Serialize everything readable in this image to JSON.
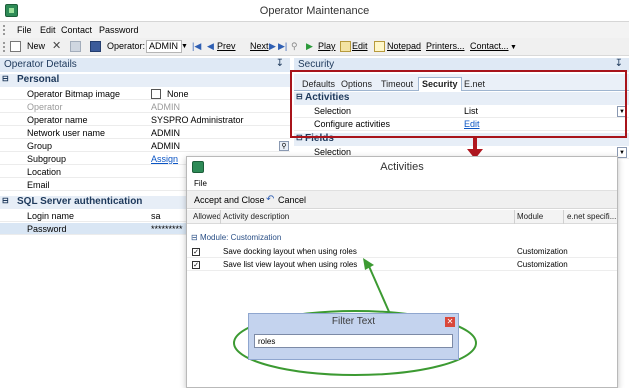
{
  "window": {
    "title": "Operator Maintenance"
  },
  "menu": [
    "File",
    "Edit",
    "Contact",
    "Password"
  ],
  "toolbar": {
    "new": "New",
    "operator_label": "Operator:",
    "operator_value": "ADMIN",
    "prev": "Prev",
    "next": "Next",
    "play": "Play",
    "edit": "Edit",
    "notepad": "Notepad",
    "printers": "Printers...",
    "contact": "Contact..."
  },
  "operator_details": {
    "title": "Operator Details",
    "pin": "↧",
    "personal_header": "Personal",
    "rows": [
      {
        "label": "Operator Bitmap image",
        "value": "None"
      },
      {
        "label": "Operator",
        "value": "ADMIN"
      },
      {
        "label": "Operator name",
        "value": "SYSPRO Administrator"
      },
      {
        "label": "Network user name",
        "value": "ADMIN"
      },
      {
        "label": "Group",
        "value": "ADMIN"
      },
      {
        "label": "Subgroup",
        "value": "Assign"
      },
      {
        "label": "Location",
        "value": ""
      },
      {
        "label": "Email",
        "value": ""
      }
    ],
    "sql_header": "SQL Server authentication",
    "sql_rows": [
      {
        "label": "Login name",
        "value": "sa"
      },
      {
        "label": "Password",
        "value": "*********"
      }
    ]
  },
  "security": {
    "title": "Security",
    "pin": "↧",
    "tabs": [
      "Defaults",
      "Options",
      "Timeout",
      "Security",
      "E.net"
    ],
    "activities_header": "Activities",
    "rows": [
      {
        "label": "Selection",
        "value": "List"
      },
      {
        "label": "Configure activities",
        "value": "Edit"
      }
    ],
    "fields_header": "Fields",
    "fields_rows": [
      {
        "label": "Selection",
        "value": ""
      }
    ]
  },
  "activities_dialog": {
    "title": "Activities",
    "menu": "File",
    "accept_label": "Accept and Close",
    "cancel_label": "Cancel",
    "columns": [
      "Allowed",
      "Activity description",
      "Module",
      "e.net specifi..."
    ],
    "group_label": "Module: Customization",
    "rows": [
      {
        "description": "Save docking layout when using roles",
        "module": "Customization"
      },
      {
        "description": "Save list view layout when using roles",
        "module": "Customization"
      }
    ]
  },
  "filter_popup": {
    "title": "Filter Text",
    "value": "roles"
  },
  "colors": {
    "highlight_box": "#a8141b",
    "arrow_red": "#b0171f",
    "annotation_green": "#3c9a32"
  }
}
